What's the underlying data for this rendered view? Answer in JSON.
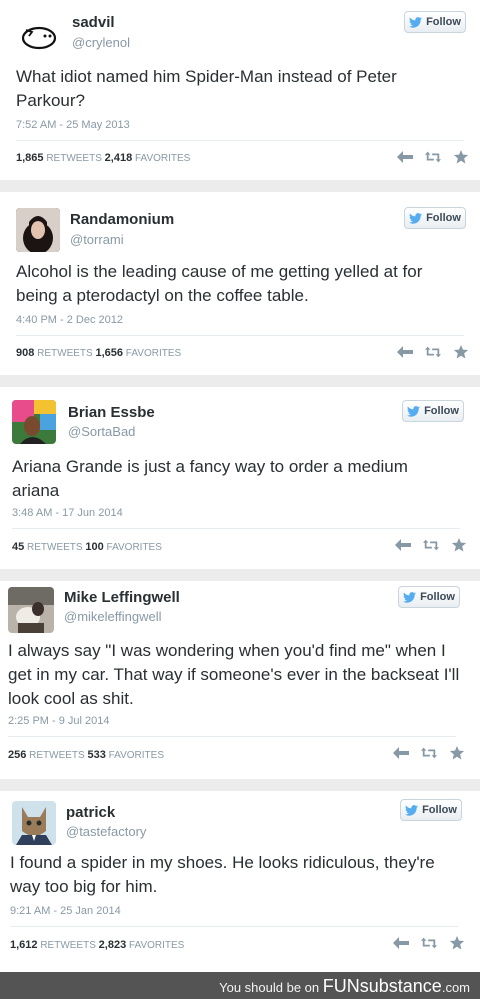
{
  "follow_label": "Follow",
  "tweets": [
    {
      "name": "sadvil",
      "handle": "@crylenol",
      "text": "What idiot named him Spider-Man instead of Peter Parkour?",
      "timestamp": "7:52 AM - 25 May 2013",
      "retweets": "1,865",
      "favorites": "2,418",
      "retweets_label": "RETWEETS",
      "favorites_label": "FAVORITES"
    },
    {
      "name": "Randamonium",
      "handle": "@torrami",
      "text": "Alcohol is the leading cause of me getting yelled at for being a pterodactyl on the coffee table.",
      "timestamp": "4:40 PM - 2 Dec 2012",
      "retweets": "908",
      "favorites": "1,656",
      "retweets_label": "RETWEETS",
      "favorites_label": "FAVORITES"
    },
    {
      "name": "Brian Essbe",
      "handle": "@SortaBad",
      "text": "Ariana Grande is just a fancy way to order a medium ariana",
      "timestamp": "3:48 AM - 17 Jun 2014",
      "retweets": "45",
      "favorites": "100",
      "retweets_label": "RETWEETS",
      "favorites_label": "FAVORITES"
    },
    {
      "name": "Mike Leffingwell",
      "handle": "@mikeleffingwell",
      "text": "I always say \"I was wondering when you'd find me\" when I get in my car. That way if someone's ever in the backseat I'll look cool as shit.",
      "timestamp": "2:25 PM - 9 Jul 2014",
      "retweets": "256",
      "favorites": "533",
      "retweets_label": "RETWEETS",
      "favorites_label": "FAVORITES"
    },
    {
      "name": "patrick",
      "handle": "@tastefactory",
      "text": "I found a spider in my shoes. He looks ridiculous, they're way too big for him.",
      "timestamp": "9:21 AM - 25 Jan 2014",
      "retweets": "1,612",
      "favorites": "2,823",
      "retweets_label": "RETWEETS",
      "favorites_label": "FAVORITES"
    }
  ],
  "footer": {
    "prefix": "You should be on",
    "brand": "FUNsubstance",
    "suffix": ".com"
  },
  "colors": {
    "twitter_blue": "#55acee",
    "text": "#292f33",
    "muted": "#8899a6",
    "footer_bg": "#545454"
  },
  "icons": [
    "twitter-bird-icon",
    "reply-icon",
    "retweet-icon",
    "favorite-star-icon"
  ]
}
